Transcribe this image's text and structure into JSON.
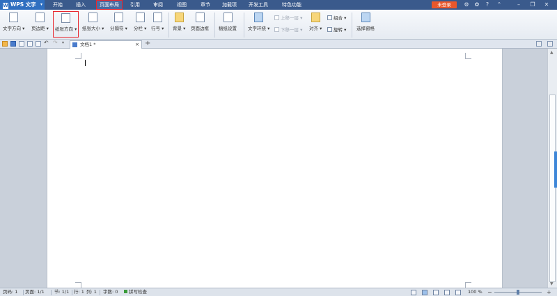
{
  "app": {
    "name": "WPS 文字",
    "logo_letter": "W"
  },
  "menu": {
    "items": [
      "开始",
      "插入",
      "页面布局",
      "引用",
      "审阅",
      "视图",
      "章节",
      "加载项",
      "开发工具",
      "特色功能"
    ],
    "active": "页面布局"
  },
  "login_label": "未登录",
  "ribbon": {
    "text_direction": "文字方向",
    "margins": "页边距",
    "paper_orientation": "纸张方向",
    "paper_size": "纸张大小",
    "separator": "分隔符",
    "columns": "分栏",
    "line_numbers": "行号",
    "background": "背景",
    "page_border": "页面边框",
    "manuscript_setup": "稿纸设置",
    "text_wrap": "文字环绕",
    "bring_forward": "上移一层",
    "send_backward": "下移一层",
    "align": "对齐",
    "group": "组合",
    "rotate": "旋转",
    "select_pane": "选择窗格",
    "dropdown_caret": "▾"
  },
  "document_tab": {
    "title": "文档1 *",
    "close": "×",
    "new_tab": "+"
  },
  "status": {
    "page_num": "页码: 1",
    "pages": "页面: 1/1",
    "section": "节: 1/1",
    "row": "行: 1",
    "col": "列: 1",
    "word_count": "字数: 0",
    "spell_check": "拼写检查",
    "zoom": "100 %",
    "zoom_minus": "−",
    "zoom_plus": "+",
    "zoom_level_percent": 100
  },
  "colors": {
    "title_bar": "#3a5a8c",
    "app_button": "#2f6fc0",
    "highlight": "#e8262d",
    "login": "#e9572b"
  }
}
